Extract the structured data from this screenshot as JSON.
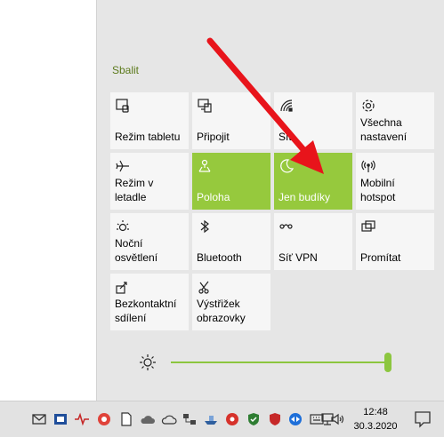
{
  "action_center": {
    "collapse_label": "Sbalit",
    "accent_color": "#96c93d",
    "tiles": [
      {
        "label": "Režim tabletu",
        "icon": "tablet-mode-icon",
        "active": false
      },
      {
        "label": "Připojit",
        "icon": "connect-icon",
        "active": false
      },
      {
        "label": "Síť",
        "icon": "network-icon",
        "active": false
      },
      {
        "label": "Všechna\nnastavení",
        "icon": "gear-icon",
        "active": false
      },
      {
        "label": "Režim v letadle",
        "icon": "airplane-icon",
        "active": false
      },
      {
        "label": "Poloha",
        "icon": "location-icon",
        "active": true
      },
      {
        "label": "Jen budíky",
        "icon": "moon-icon",
        "active": true
      },
      {
        "label": "Mobilní\nhotspot",
        "icon": "hotspot-icon",
        "active": false
      },
      {
        "label": "Noční osvětlení",
        "icon": "night-light-icon",
        "active": false
      },
      {
        "label": "Bluetooth",
        "icon": "bluetooth-icon",
        "active": false
      },
      {
        "label": "Síť VPN",
        "icon": "vpn-icon",
        "active": false
      },
      {
        "label": "Promítat",
        "icon": "project-icon",
        "active": false
      },
      {
        "label": "Bezkontaktní\nsdílení",
        "icon": "nearby-share-icon",
        "active": false
      },
      {
        "label": "Výstřižek\nobrazovky",
        "icon": "screen-snip-icon",
        "active": false
      }
    ],
    "brightness": {
      "icon": "brightness-icon",
      "level": 1.0
    }
  },
  "taskbar": {
    "time": "12:48",
    "date": "30.3.2020",
    "tray_icons": [
      "mail-icon",
      "app-icon",
      "pulse-icon",
      "chrome-icon",
      "file-icon",
      "cloud-icon",
      "onedrive-icon",
      "network-app-icon",
      "ship-icon",
      "media-icon",
      "shield-icon",
      "security-icon",
      "teamviewer-icon",
      "keyboard-icon",
      "network-icon",
      "volume-icon"
    ],
    "notification_icon": "notification-icon"
  },
  "annotation": {
    "arrow_color": "#e8141b"
  }
}
